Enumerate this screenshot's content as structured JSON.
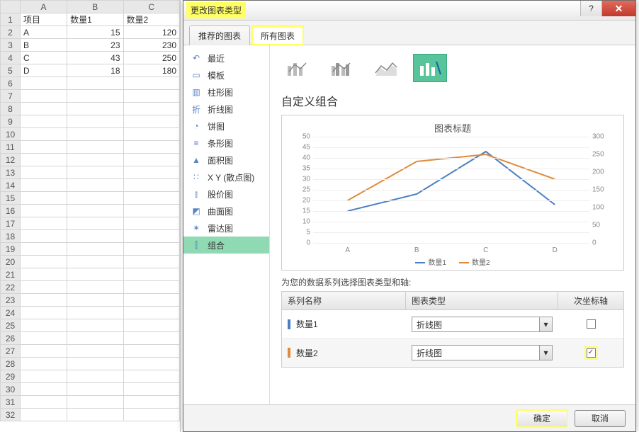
{
  "sheet": {
    "cols": [
      "A",
      "B",
      "C"
    ],
    "row_hdrs": [
      1,
      2,
      3,
      4,
      5,
      6,
      7,
      8,
      9,
      10,
      11,
      12,
      13,
      14,
      15,
      16,
      17,
      18,
      19,
      20,
      21,
      22,
      23,
      24,
      25,
      26,
      27,
      28,
      29,
      30,
      31,
      32
    ],
    "data": [
      [
        "项目",
        "数量1",
        "数量2"
      ],
      [
        "A",
        "15",
        "120"
      ],
      [
        "B",
        "23",
        "230"
      ],
      [
        "C",
        "43",
        "250"
      ],
      [
        "D",
        "18",
        "180"
      ]
    ]
  },
  "dialog": {
    "title": "更改图表类型",
    "tabs": {
      "rec": "推荐的图表",
      "all": "所有图表"
    },
    "types": [
      {
        "icon": "recent",
        "label": "最近"
      },
      {
        "icon": "template",
        "label": "模板"
      },
      {
        "icon": "bar",
        "label": "柱形图"
      },
      {
        "icon": "line",
        "label": "折线图"
      },
      {
        "icon": "pie",
        "label": "饼图"
      },
      {
        "icon": "hbar",
        "label": "条形图"
      },
      {
        "icon": "area",
        "label": "面积图"
      },
      {
        "icon": "scatter",
        "label": "X Y (散点图)"
      },
      {
        "icon": "stock",
        "label": "股价图"
      },
      {
        "icon": "surface",
        "label": "曲面图"
      },
      {
        "icon": "radar",
        "label": "雷达图"
      },
      {
        "icon": "combo",
        "label": "组合"
      }
    ],
    "subtitle": "自定义组合",
    "series_choose_label": "为您的数据系列选择图表类型和轴:",
    "series_table": {
      "h_name": "系列名称",
      "h_type": "图表类型",
      "h_axis": "次坐标轴",
      "rows": [
        {
          "name": "数量1",
          "type": "折线图",
          "secondary": false,
          "color": "#4a7fc1"
        },
        {
          "name": "数量2",
          "type": "折线图",
          "secondary": true,
          "color": "#e08a3c"
        }
      ]
    },
    "buttons": {
      "ok": "确定",
      "cancel": "取消"
    },
    "chart": {
      "title": "图表标题",
      "legend": [
        "数量1",
        "数量2"
      ]
    }
  },
  "chart_data": {
    "type": "line",
    "categories": [
      "A",
      "B",
      "C",
      "D"
    ],
    "series": [
      {
        "name": "数量1",
        "values": [
          15,
          23,
          43,
          18
        ],
        "axis": "primary",
        "color": "#4a7fc1"
      },
      {
        "name": "数量2",
        "values": [
          120,
          230,
          250,
          180
        ],
        "axis": "secondary",
        "color": "#e08a3c"
      }
    ],
    "y_primary": {
      "min": 0,
      "max": 50,
      "ticks": [
        0,
        5,
        10,
        15,
        20,
        25,
        30,
        35,
        40,
        45,
        50
      ]
    },
    "y_secondary": {
      "min": 0,
      "max": 300,
      "ticks": [
        0,
        50,
        100,
        150,
        200,
        250,
        300
      ]
    },
    "title": "图表标题"
  }
}
